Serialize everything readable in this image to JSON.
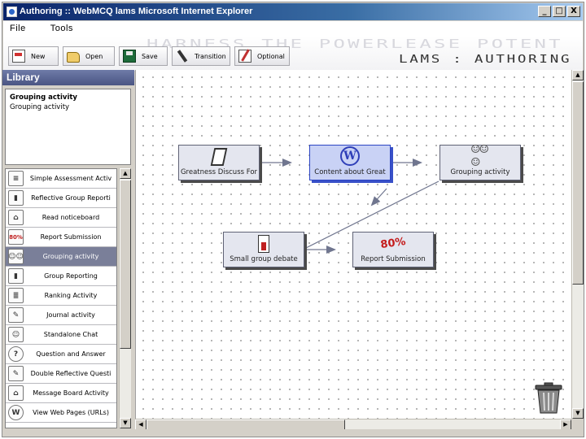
{
  "window": {
    "title": "Authoring :: WebMCQ   lams   Microsoft Internet Explorer",
    "controls": {
      "minimize": "_",
      "maximize": "□",
      "close": "X"
    }
  },
  "menu": {
    "items": [
      "File",
      "Tools"
    ]
  },
  "banner": {
    "tagline": "HARNESS THE POWERLEASE POTENT",
    "brand": "LAMS : AUTHORING"
  },
  "toolbar": {
    "new": "New",
    "open": "Open",
    "save": "Save",
    "transition": "Transition",
    "optional": "Optional"
  },
  "library": {
    "title": "Library",
    "description": {
      "heading": "Grouping activity",
      "text": "Grouping activity"
    },
    "items": [
      {
        "label": "Simple Assessment Activ",
        "icon": "checklist-icon",
        "glyph": "≡"
      },
      {
        "label": "Reflective Group Reporti",
        "icon": "report-icon",
        "glyph": "▮"
      },
      {
        "label": "Read noticeboard",
        "icon": "noticeboard-icon",
        "glyph": "⌂"
      },
      {
        "label": "Report Submission",
        "icon": "score-icon",
        "glyph": "80%"
      },
      {
        "label": "Grouping activity",
        "icon": "group-icon",
        "glyph": "☺☺",
        "selected": true
      },
      {
        "label": "Group Reporting",
        "icon": "report-icon",
        "glyph": "▮"
      },
      {
        "label": "Ranking Activity",
        "icon": "ranking-icon",
        "glyph": "≣"
      },
      {
        "label": "Journal activity",
        "icon": "journal-icon",
        "glyph": "✎"
      },
      {
        "label": "Standalone Chat",
        "icon": "chat-icon",
        "glyph": "☺"
      },
      {
        "label": "Question and Answer",
        "icon": "question-icon",
        "glyph": "?"
      },
      {
        "label": "Double Reflective Questi",
        "icon": "reflective-icon",
        "glyph": "✎"
      },
      {
        "label": "Message Board Activity",
        "icon": "message-board-icon",
        "glyph": "⌂"
      },
      {
        "label": "View Web Pages (URLs)",
        "icon": "web-icon",
        "glyph": "W"
      }
    ]
  },
  "canvas": {
    "activities": [
      {
        "id": "a1",
        "label": "Greatness Discuss For",
        "icon": "noticeboard-icon",
        "glyph": ""
      },
      {
        "id": "a2",
        "label": "Content about Great",
        "icon": "web-icon",
        "glyph": "W",
        "active": true
      },
      {
        "id": "a3",
        "label": "Grouping activity",
        "icon": "group-icon",
        "glyph": "☺☺☺"
      },
      {
        "id": "a4",
        "label": "Small group debate",
        "icon": "debate-icon",
        "glyph": ""
      },
      {
        "id": "a5",
        "label": "Report Submission",
        "icon": "score-icon",
        "glyph": "80%"
      }
    ]
  },
  "colors": {
    "titlebar": "#0a246a",
    "library_header": "#4a5583",
    "selected_item": "#7a7f99",
    "active_node_border": "#2c45c4",
    "arrow": "#70768f"
  }
}
